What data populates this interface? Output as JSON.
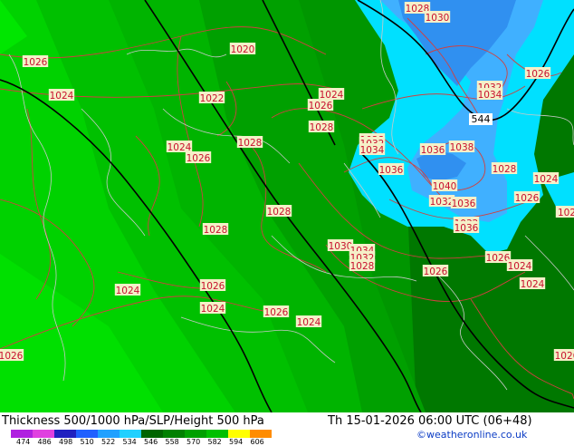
{
  "footer": {
    "title": "Thickness 500/1000 hPa/SLP/Height 500 hPa",
    "valid_time": "Th 15-01-2026 06:00 UTC (06+48)",
    "credit": "©weatheronline.co.uk"
  },
  "legend": {
    "ticks": [
      "474",
      "486",
      "498",
      "510",
      "522",
      "534",
      "546",
      "558",
      "570",
      "582",
      "594",
      "606"
    ],
    "colors": [
      "#b020e0",
      "#e040e0",
      "#2020c0",
      "#2060ff",
      "#20a0ff",
      "#20d0ff",
      "#006400",
      "#008000",
      "#00a000",
      "#00c000",
      "#ffff00",
      "#ff8c00"
    ]
  },
  "map": {
    "colors": {
      "green_dark": "#007800",
      "green_mid": "#00a000",
      "green_light": "#00c000",
      "green_bright": "#00e000",
      "cyan": "#00e0ff",
      "blue_light": "#40b0ff",
      "blue": "#3090f0",
      "isobar": "#d04040",
      "height_line": "#000000",
      "coast": "#c0c0c0"
    },
    "height_label": "544",
    "pressure_labels": [
      {
        "text": "1028"
      },
      {
        "text": "1030"
      },
      {
        "text": "1026"
      },
      {
        "text": "1020"
      },
      {
        "text": "1026"
      },
      {
        "text": "1024"
      },
      {
        "text": "1022"
      },
      {
        "text": "1024"
      },
      {
        "text": "1026"
      },
      {
        "text": "1028"
      },
      {
        "text": "1032"
      },
      {
        "text": "1034"
      },
      {
        "text": "1028"
      },
      {
        "text": "1024"
      },
      {
        "text": "1028"
      },
      {
        "text": "1026"
      },
      {
        "text": "1032"
      },
      {
        "text": "1034"
      },
      {
        "text": "1036"
      },
      {
        "text": "1038"
      },
      {
        "text": "1036"
      },
      {
        "text": "1028"
      },
      {
        "text": "1024"
      },
      {
        "text": "1040"
      },
      {
        "text": "1026"
      },
      {
        "text": "1032"
      },
      {
        "text": "1036"
      },
      {
        "text": "1028"
      },
      {
        "text": "1028"
      },
      {
        "text": "1032"
      },
      {
        "text": "1036"
      },
      {
        "text": "1026"
      },
      {
        "text": "1030"
      },
      {
        "text": "1034"
      },
      {
        "text": "1032"
      },
      {
        "text": "1028"
      },
      {
        "text": "1026"
      },
      {
        "text": "1026"
      },
      {
        "text": "1024"
      },
      {
        "text": "1024"
      },
      {
        "text": "1024"
      },
      {
        "text": "1026"
      },
      {
        "text": "1024"
      },
      {
        "text": "1026"
      },
      {
        "text": "1024"
      },
      {
        "text": "1026"
      },
      {
        "text": "1026"
      },
      {
        "text": "102"
      }
    ]
  }
}
